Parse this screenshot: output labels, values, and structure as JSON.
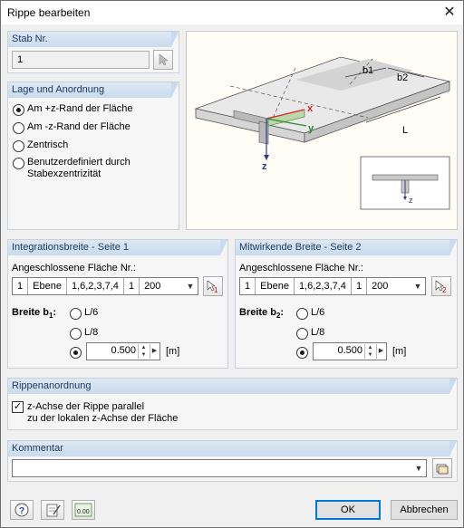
{
  "window": {
    "title": "Rippe bearbeiten"
  },
  "stab": {
    "header": "Stab Nr.",
    "value": "1"
  },
  "lage": {
    "header": "Lage und Anordnung",
    "options": [
      {
        "label": "Am +z-Rand der Fläche",
        "selected": true
      },
      {
        "label": "Am -z-Rand der Fläche",
        "selected": false
      },
      {
        "label": "Zentrisch",
        "selected": false
      },
      {
        "label_line1": "Benutzerdefiniert durch",
        "label_line2": "Stabexzentrizität",
        "selected": false
      }
    ]
  },
  "diagram": {
    "label_b1": "b1",
    "label_b2": "b2",
    "label_L": "L",
    "label_x": "x",
    "label_y": "y",
    "label_z": "z",
    "inset_z": "z"
  },
  "integration": {
    "header": "Integrationsbreite - Seite 1",
    "surface_label": "Angeschlossene Fläche Nr.:",
    "combo": [
      "1",
      "Ebene",
      "1,6,2,3,7,4",
      "1",
      "200"
    ],
    "width_label": "Breite b",
    "width_sub": "1",
    "width_suffix": ":",
    "opt1": "L/6",
    "opt2": "L/8",
    "value": "0.500",
    "unit": "[m]"
  },
  "mitwirkende": {
    "header": "Mitwirkende Breite - Seite 2",
    "surface_label": "Angeschlossene Fläche Nr.:",
    "combo": [
      "1",
      "Ebene",
      "1,6,2,3,7,4",
      "1",
      "200"
    ],
    "width_label": "Breite b",
    "width_sub": "2",
    "width_suffix": ":",
    "opt1": "L/6",
    "opt2": "L/8",
    "value": "0.500",
    "unit": "[m]"
  },
  "rippen": {
    "header": "Rippenanordnung",
    "check_line1": "z-Achse der Rippe parallel",
    "check_line2": "zu der lokalen z-Achse der Fläche",
    "checked": true
  },
  "kommentar": {
    "header": "Kommentar",
    "value": ""
  },
  "footer": {
    "ok": "OK",
    "cancel": "Abbrechen",
    "units_icon_text": "0.00"
  }
}
